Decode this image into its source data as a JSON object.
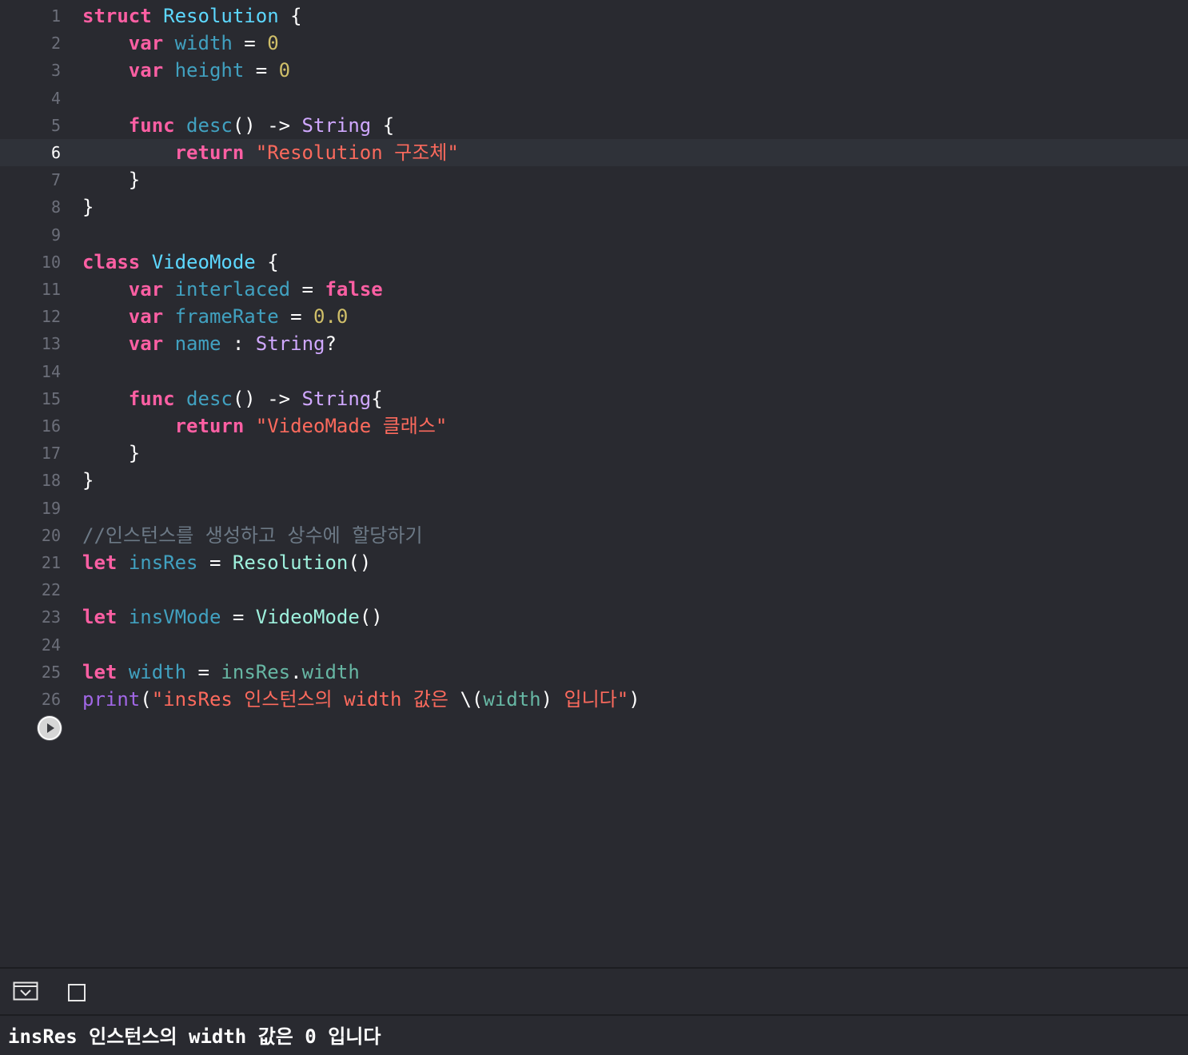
{
  "colors": {
    "background": "#292a30",
    "current_line": "#2f3239",
    "keyword": "#fc5fa3",
    "type_decl": "#5dd8ff",
    "identifier": "#41a1c0",
    "type_name": "#d0a8ff",
    "number": "#d0bf69",
    "string": "#fc6a5d",
    "plain": "#ffffff",
    "comment": "#6c7986",
    "project_type": "#9ef1dd",
    "project_var": "#67b7a4",
    "call": "#a167e6",
    "line_number": "#6c6f7a"
  },
  "editor": {
    "current_line": 6,
    "lines": [
      {
        "n": "1",
        "tokens": [
          {
            "t": "struct",
            "c": "keyword"
          },
          {
            "t": " ",
            "c": "plain"
          },
          {
            "t": "Resolution",
            "c": "type_decl"
          },
          {
            "t": " {",
            "c": "plain"
          }
        ]
      },
      {
        "n": "2",
        "tokens": [
          {
            "t": "    ",
            "c": "plain"
          },
          {
            "t": "var",
            "c": "keyword"
          },
          {
            "t": " ",
            "c": "plain"
          },
          {
            "t": "width",
            "c": "identifier"
          },
          {
            "t": " = ",
            "c": "plain"
          },
          {
            "t": "0",
            "c": "number"
          }
        ]
      },
      {
        "n": "3",
        "tokens": [
          {
            "t": "    ",
            "c": "plain"
          },
          {
            "t": "var",
            "c": "keyword"
          },
          {
            "t": " ",
            "c": "plain"
          },
          {
            "t": "height",
            "c": "identifier"
          },
          {
            "t": " = ",
            "c": "plain"
          },
          {
            "t": "0",
            "c": "number"
          }
        ]
      },
      {
        "n": "4",
        "tokens": []
      },
      {
        "n": "5",
        "tokens": [
          {
            "t": "    ",
            "c": "plain"
          },
          {
            "t": "func",
            "c": "keyword"
          },
          {
            "t": " ",
            "c": "plain"
          },
          {
            "t": "desc",
            "c": "identifier"
          },
          {
            "t": "() -> ",
            "c": "plain"
          },
          {
            "t": "String",
            "c": "type_name"
          },
          {
            "t": " {",
            "c": "plain"
          }
        ]
      },
      {
        "n": "6",
        "tokens": [
          {
            "t": "        ",
            "c": "plain"
          },
          {
            "t": "return",
            "c": "keyword"
          },
          {
            "t": " ",
            "c": "plain"
          },
          {
            "t": "\"Resolution 구조체\"",
            "c": "string"
          }
        ]
      },
      {
        "n": "7",
        "tokens": [
          {
            "t": "    }",
            "c": "plain"
          }
        ]
      },
      {
        "n": "8",
        "tokens": [
          {
            "t": "}",
            "c": "plain"
          }
        ]
      },
      {
        "n": "9",
        "tokens": []
      },
      {
        "n": "10",
        "tokens": [
          {
            "t": "class",
            "c": "keyword"
          },
          {
            "t": " ",
            "c": "plain"
          },
          {
            "t": "VideoMode",
            "c": "type_decl"
          },
          {
            "t": " {",
            "c": "plain"
          }
        ]
      },
      {
        "n": "11",
        "tokens": [
          {
            "t": "    ",
            "c": "plain"
          },
          {
            "t": "var",
            "c": "keyword"
          },
          {
            "t": " ",
            "c": "plain"
          },
          {
            "t": "interlaced",
            "c": "identifier"
          },
          {
            "t": " = ",
            "c": "plain"
          },
          {
            "t": "false",
            "c": "keyword"
          }
        ]
      },
      {
        "n": "12",
        "tokens": [
          {
            "t": "    ",
            "c": "plain"
          },
          {
            "t": "var",
            "c": "keyword"
          },
          {
            "t": " ",
            "c": "plain"
          },
          {
            "t": "frameRate",
            "c": "identifier"
          },
          {
            "t": " = ",
            "c": "plain"
          },
          {
            "t": "0.0",
            "c": "number"
          }
        ]
      },
      {
        "n": "13",
        "tokens": [
          {
            "t": "    ",
            "c": "plain"
          },
          {
            "t": "var",
            "c": "keyword"
          },
          {
            "t": " ",
            "c": "plain"
          },
          {
            "t": "name",
            "c": "identifier"
          },
          {
            "t": " : ",
            "c": "plain"
          },
          {
            "t": "String",
            "c": "type_name"
          },
          {
            "t": "?",
            "c": "plain"
          }
        ]
      },
      {
        "n": "14",
        "tokens": []
      },
      {
        "n": "15",
        "tokens": [
          {
            "t": "    ",
            "c": "plain"
          },
          {
            "t": "func",
            "c": "keyword"
          },
          {
            "t": " ",
            "c": "plain"
          },
          {
            "t": "desc",
            "c": "identifier"
          },
          {
            "t": "() -> ",
            "c": "plain"
          },
          {
            "t": "String",
            "c": "type_name"
          },
          {
            "t": "{",
            "c": "plain"
          }
        ]
      },
      {
        "n": "16",
        "tokens": [
          {
            "t": "        ",
            "c": "plain"
          },
          {
            "t": "return",
            "c": "keyword"
          },
          {
            "t": " ",
            "c": "plain"
          },
          {
            "t": "\"VideoMade 클래스\"",
            "c": "string"
          }
        ]
      },
      {
        "n": "17",
        "tokens": [
          {
            "t": "    }",
            "c": "plain"
          }
        ]
      },
      {
        "n": "18",
        "tokens": [
          {
            "t": "}",
            "c": "plain"
          }
        ]
      },
      {
        "n": "19",
        "tokens": []
      },
      {
        "n": "20",
        "tokens": [
          {
            "t": "//인스턴스를 생성하고 상수에 할당하기",
            "c": "comment"
          }
        ]
      },
      {
        "n": "21",
        "tokens": [
          {
            "t": "let",
            "c": "keyword"
          },
          {
            "t": " ",
            "c": "plain"
          },
          {
            "t": "insRes",
            "c": "identifier"
          },
          {
            "t": " = ",
            "c": "plain"
          },
          {
            "t": "Resolution",
            "c": "project_type"
          },
          {
            "t": "()",
            "c": "plain"
          }
        ]
      },
      {
        "n": "22",
        "tokens": []
      },
      {
        "n": "23",
        "tokens": [
          {
            "t": "let",
            "c": "keyword"
          },
          {
            "t": " ",
            "c": "plain"
          },
          {
            "t": "insVMode",
            "c": "identifier"
          },
          {
            "t": " = ",
            "c": "plain"
          },
          {
            "t": "VideoMode",
            "c": "project_type"
          },
          {
            "t": "()",
            "c": "plain"
          }
        ]
      },
      {
        "n": "24",
        "tokens": []
      },
      {
        "n": "25",
        "tokens": [
          {
            "t": "let",
            "c": "keyword"
          },
          {
            "t": " ",
            "c": "plain"
          },
          {
            "t": "width",
            "c": "identifier"
          },
          {
            "t": " = ",
            "c": "plain"
          },
          {
            "t": "insRes",
            "c": "project_var"
          },
          {
            "t": ".",
            "c": "plain"
          },
          {
            "t": "width",
            "c": "project_var"
          }
        ]
      },
      {
        "n": "26",
        "tokens": [
          {
            "t": "print",
            "c": "call"
          },
          {
            "t": "(",
            "c": "plain"
          },
          {
            "t": "\"insRes 인스턴스의 width 값은 ",
            "c": "string"
          },
          {
            "t": "\\(",
            "c": "plain"
          },
          {
            "t": "width",
            "c": "project_var"
          },
          {
            "t": ")",
            "c": "plain"
          },
          {
            "t": " 입니다\"",
            "c": "string"
          },
          {
            "t": ")",
            "c": "plain"
          }
        ]
      }
    ]
  },
  "run_button": {
    "icon": "play-circle-icon"
  },
  "bottom_bar": {
    "hide_debug_icon": "hide-debug-area-icon",
    "console_toggle_icon": "console-toggle-icon"
  },
  "console": {
    "output": "insRes 인스턴스의 width 값은 0 입니다"
  }
}
